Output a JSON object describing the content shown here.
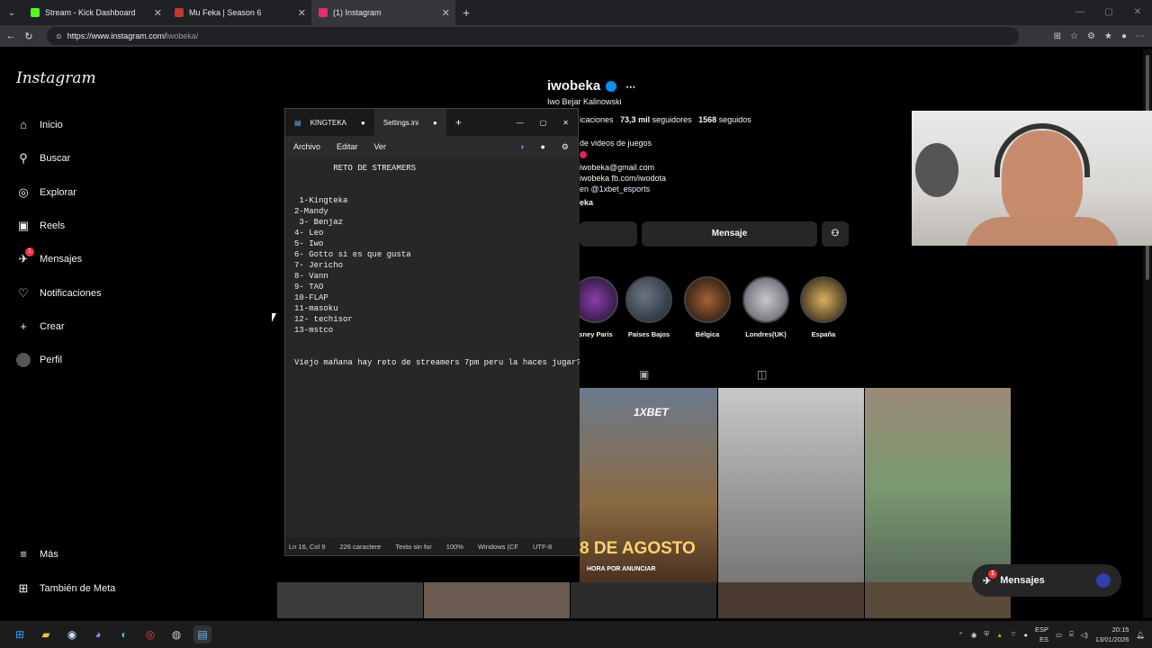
{
  "browser": {
    "tabs": [
      {
        "title": "Stream - Kick Dashboard",
        "color": "#53fc18"
      },
      {
        "title": "Mu Feka | Season 6",
        "color": "#c0392b"
      },
      {
        "title": "(1) Instagram",
        "color": "#e1306c"
      }
    ],
    "url_host": "https://www.instagram.com/",
    "url_path": "iwobeka/"
  },
  "instagram": {
    "logo": "Instagram",
    "nav": [
      {
        "label": "Inicio",
        "icon": "home-icon"
      },
      {
        "label": "Buscar",
        "icon": "search-icon"
      },
      {
        "label": "Explorar",
        "icon": "compass-icon"
      },
      {
        "label": "Reels",
        "icon": "reels-icon"
      },
      {
        "label": "Mensajes",
        "icon": "messenger-icon",
        "badge": "1"
      },
      {
        "label": "Notificaciones",
        "icon": "heart-icon"
      },
      {
        "label": "Crear",
        "icon": "plus-icon"
      },
      {
        "label": "Perfil",
        "icon": "avatar-icon"
      }
    ],
    "more": "Más",
    "meta": "También de Meta",
    "profile": {
      "username": "iwobeka",
      "fullname": "Iwo Bejar Kalinowski",
      "pubs_partial": "icaciones",
      "followers": "73,3 mil",
      "followers_label": "seguidores",
      "following": "1568",
      "following_label": "seguidos",
      "bio": [
        "de videos de juegos",
        "",
        "iwobeka@gmail.com",
        "iwobeka fb.com/iwodota",
        "en @1xbet_esports",
        "eka"
      ],
      "message_btn": "Mensaje"
    },
    "stories": [
      {
        "label": "isney Paris"
      },
      {
        "label": "Países Bajos"
      },
      {
        "label": "Bélgica"
      },
      {
        "label": "Londres(UK)"
      },
      {
        "label": "España"
      }
    ],
    "post_text": {
      "brand": "1XBET",
      "date": "8 DE AGOSTO",
      "sub": "HORA POR ANUNCIAR"
    },
    "messages_pill": "Mensajes",
    "messages_badge": "1"
  },
  "notepad": {
    "tabs": [
      "KINGTEKA",
      "Settings.ini"
    ],
    "menu": [
      "Archivo",
      "Editar",
      "Ver"
    ],
    "content": "        RETO DE STREAMERS\n\n\n 1-Kingteka\n2-Mandy\n 3- Benjaz\n4- Leo\n5- Iwo\n6- Gotto si es que gusta\n7- Jericho\n8- Vann\n9- TAO\n10-FLAP\n11-masoku\n12- techisor\n13-mstco\n\n\nViejo mañana hay reto de streamers 7pm peru la haces jugar?",
    "status": [
      "Ln 16, Col 9",
      "226 caractere",
      "Texto sin for",
      "100%",
      "Windows (CF",
      "UTF-8"
    ]
  },
  "taskbar": {
    "lang": "ESP",
    "lang2": "ES",
    "time": "20:15",
    "date": "13/01/2026"
  }
}
